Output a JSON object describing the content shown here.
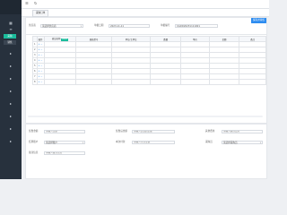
{
  "sidebar": {
    "icons": [
      "grid-icon",
      "menu-icon"
    ],
    "items": [
      {
        "label": "采购",
        "state": "active"
      },
      {
        "label": "销售",
        "state": "dark"
      }
    ],
    "arrows": [
      "▸",
      "▸",
      "▸",
      "▸",
      "▸",
      "▸",
      "▸",
      "▸"
    ]
  },
  "topbar": {
    "icons": [
      "☰",
      "↻"
    ]
  },
  "tabs": [
    {
      "label": "采购订单"
    }
  ],
  "header": {
    "fields": [
      {
        "label": "供应商",
        "value": "请选择供应商"
      },
      {
        "label": "单据日期",
        "value": "2023-11-11"
      },
      {
        "label": "单据编号",
        "value": "CGDD20231111001"
      }
    ],
    "save_label": "保存并审核"
  },
  "table": {
    "columns": [
      "操作",
      "商品名称",
      "规格型号",
      "单位/主单位",
      "数量",
      "单价",
      "金额",
      "备注"
    ],
    "badge": "多单位",
    "rows": [
      {
        "no": "1",
        "actions": "+ −"
      },
      {
        "no": "2",
        "actions": "+ −"
      },
      {
        "no": "3",
        "actions": "+ −"
      },
      {
        "no": "4",
        "actions": "+ −"
      },
      {
        "no": "5",
        "actions": "+ −"
      },
      {
        "no": "6",
        "actions": "+ −"
      },
      {
        "no": "7",
        "actions": "+ −"
      },
      {
        "no": "8",
        "actions": "+ −"
      }
    ]
  },
  "footer": {
    "fields": [
      {
        "label": "优惠金额",
        "placeholder": "请输入金额"
      },
      {
        "label": "优惠后金额",
        "placeholder": "请输入优惠后金额"
      },
      {
        "label": "其他费用",
        "placeholder": "请输入其他费用"
      },
      {
        "label": "结算账户",
        "value": "请选择账户"
      },
      {
        "label": "本次付款",
        "placeholder": "请输入付款金额"
      },
      {
        "label": "采购员",
        "value": "请选择采购员"
      },
      {
        "label": "备注信息",
        "placeholder": "请输入备注信息"
      }
    ]
  }
}
